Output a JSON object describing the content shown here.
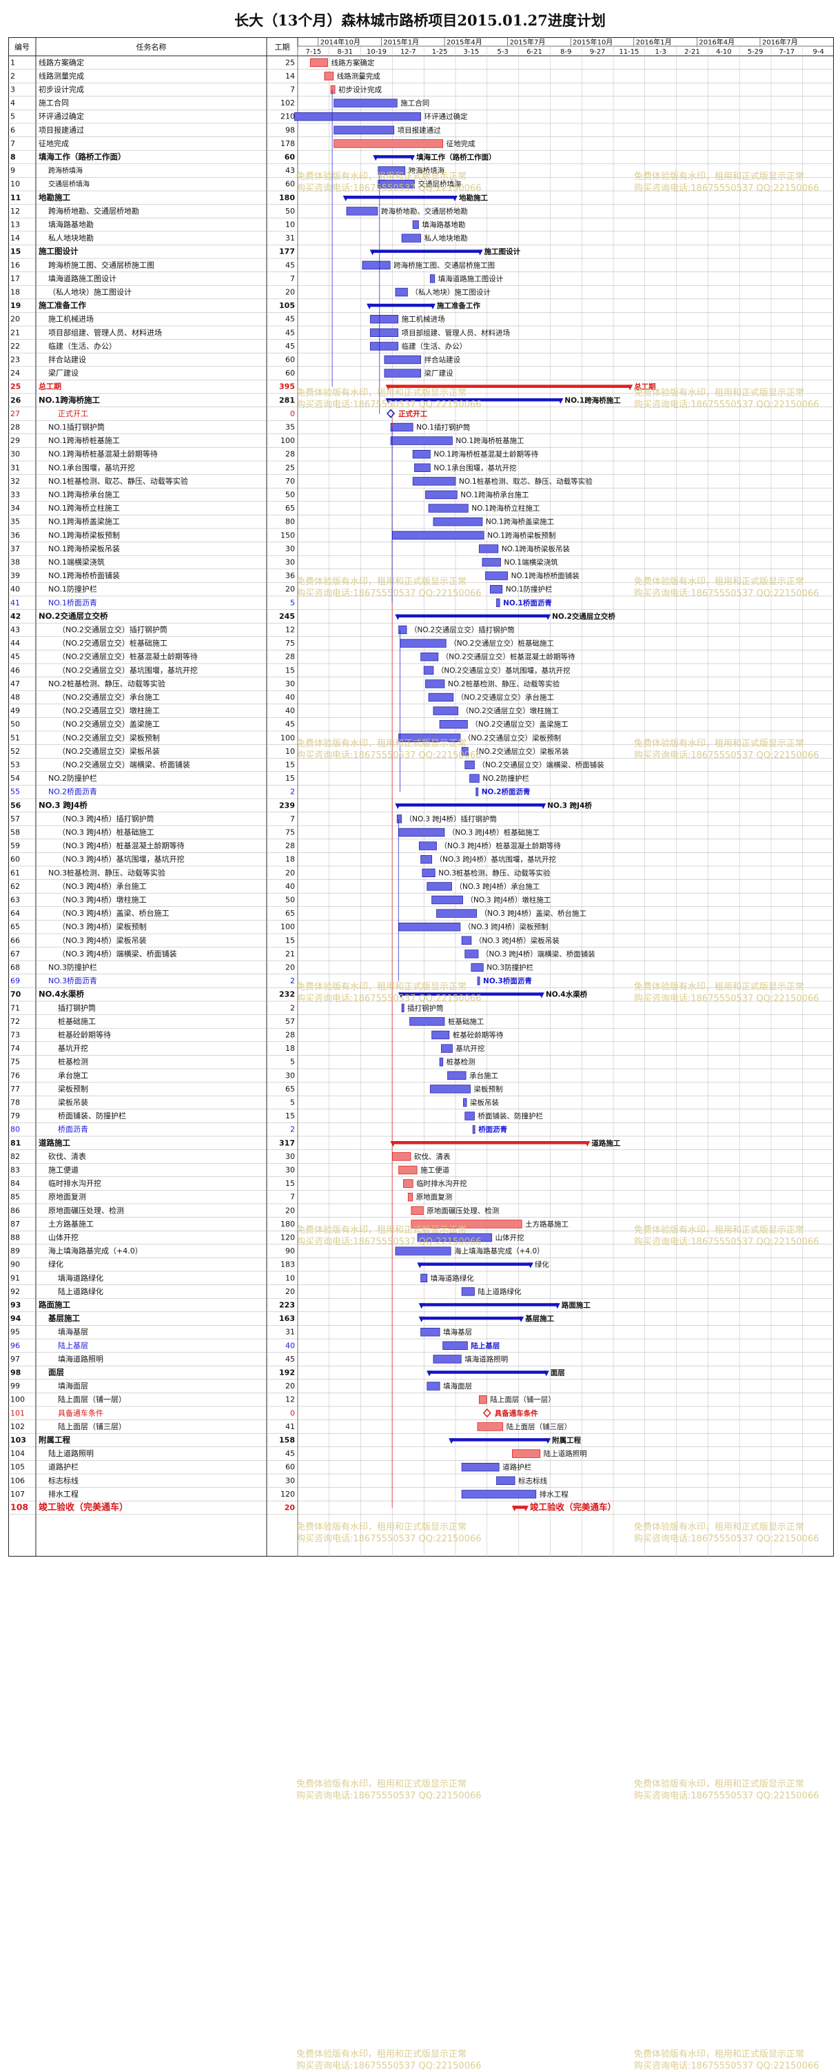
{
  "title": "长大（13个月）森林城市路桥项目2015.01.27进度计划",
  "headers": {
    "id": "编号",
    "name": "任务名称",
    "duration": "工期"
  },
  "timeline": {
    "months": [
      "2014年10月",
      "2015年1月",
      "2015年4月",
      "2015年7月",
      "2015年10月",
      "2016年1月",
      "2016年4月",
      "2016年7月"
    ],
    "weeks": [
      "7-15",
      "8-31",
      "10-19",
      "12-7",
      "1-25",
      "3-15",
      "5-3",
      "6-21",
      "8-9",
      "9-27",
      "11-15",
      "1-3",
      "2-21",
      "4-10",
      "5-29",
      "7-17",
      "9-4"
    ]
  },
  "watermark": {
    "line1": "免费体验版有水印，租用和正式版显示正常",
    "line2": "购买咨询电话:18675550537 QQ:22150066"
  },
  "colors": {
    "normal": "#6a6ae6",
    "summary": "#1414c8",
    "critical": "#e02020",
    "critical_light": "#f08080",
    "blue_text": "#1a1ad8",
    "red_text": "#d81818"
  },
  "tasks": [
    {
      "id": "1",
      "name": "线路方案确定",
      "dur": "25"
    },
    {
      "id": "2",
      "name": "线路测量完成",
      "dur": "14"
    },
    {
      "id": "3",
      "name": "初步设计完成",
      "dur": "7"
    },
    {
      "id": "4",
      "name": "施工合同",
      "dur": "102"
    },
    {
      "id": "5",
      "name": "环评通过确定",
      "dur": "210"
    },
    {
      "id": "6",
      "name": "项目报建通过",
      "dur": "98"
    },
    {
      "id": "7",
      "name": "征地完成",
      "dur": "178"
    },
    {
      "id": "8",
      "name": "填海工作（路桥工作面）",
      "dur": "60",
      "style": "summary"
    },
    {
      "id": "9",
      "name": "跨海桥填海",
      "dur": "43",
      "indent": 1,
      "small": true
    },
    {
      "id": "10",
      "name": "交通层桥填海",
      "dur": "60",
      "indent": 1,
      "small": true
    },
    {
      "id": "11",
      "name": "地勘施工",
      "dur": "180",
      "style": "summary"
    },
    {
      "id": "12",
      "name": "跨海桥地勘、交通层桥地勘",
      "dur": "50",
      "indent": 1
    },
    {
      "id": "13",
      "name": "填海路基地勘",
      "dur": "10",
      "indent": 1
    },
    {
      "id": "14",
      "name": "私人地块地勘",
      "dur": "31",
      "indent": 1
    },
    {
      "id": "15",
      "name": "施工图设计",
      "dur": "177",
      "style": "summary"
    },
    {
      "id": "16",
      "name": "跨海桥施工图、交通层桥施工图",
      "dur": "45",
      "indent": 1
    },
    {
      "id": "17",
      "name": "填海道路施工图设计",
      "dur": "7",
      "indent": 1
    },
    {
      "id": "18",
      "name": "（私人地块）施工图设计",
      "dur": "20",
      "indent": 1
    },
    {
      "id": "19",
      "name": "施工准备工作",
      "dur": "105",
      "style": "summary"
    },
    {
      "id": "20",
      "name": "施工机械进场",
      "dur": "45",
      "indent": 1
    },
    {
      "id": "21",
      "name": "项目部组建、管理人员、材料进场",
      "dur": "45",
      "indent": 1
    },
    {
      "id": "22",
      "name": "临建（生活、办公）",
      "dur": "45",
      "indent": 1
    },
    {
      "id": "23",
      "name": "拌合站建设",
      "dur": "60",
      "indent": 1
    },
    {
      "id": "24",
      "name": "梁厂建设",
      "dur": "60",
      "indent": 1
    },
    {
      "id": "25",
      "name": "总工期",
      "dur": "395",
      "style": "red"
    },
    {
      "id": "26",
      "name": "NO.1跨海桥施工",
      "dur": "281",
      "style": "summary"
    },
    {
      "id": "27",
      "name": "正式开工",
      "dur": "0",
      "style": "red",
      "indent": 2
    },
    {
      "id": "28",
      "name": "NO.1插打钢护筒",
      "dur": "35",
      "indent": 1
    },
    {
      "id": "29",
      "name": "NO.1跨海桥桩基施工",
      "dur": "100",
      "indent": 1
    },
    {
      "id": "30",
      "name": "NO.1跨海桥桩基混凝土龄期等待",
      "dur": "28",
      "indent": 1
    },
    {
      "id": "31",
      "name": "NO.1承台围堰，基坑开挖",
      "dur": "25",
      "indent": 1
    },
    {
      "id": "32",
      "name": "NO.1桩基检测、取芯、静压、动载等实验",
      "dur": "70",
      "indent": 1
    },
    {
      "id": "33",
      "name": "NO.1跨海桥承台施工",
      "dur": "50",
      "indent": 1
    },
    {
      "id": "34",
      "name": "NO.1跨海桥立柱施工",
      "dur": "65",
      "indent": 1
    },
    {
      "id": "35",
      "name": "NO.1跨海桥盖梁施工",
      "dur": "80",
      "indent": 1
    },
    {
      "id": "36",
      "name": "NO.1跨海桥梁板预制",
      "dur": "150",
      "indent": 1
    },
    {
      "id": "37",
      "name": "NO.1跨海桥梁板吊装",
      "dur": "30",
      "indent": 1
    },
    {
      "id": "38",
      "name": "NO.1端横梁浇筑",
      "dur": "30",
      "indent": 1
    },
    {
      "id": "39",
      "name": "NO.1跨海桥桥面铺装",
      "dur": "36",
      "indent": 1
    },
    {
      "id": "40",
      "name": "NO.1防撞护栏",
      "dur": "20",
      "indent": 1
    },
    {
      "id": "41",
      "name": "NO.1桥面沥青",
      "dur": "5",
      "style": "blue",
      "indent": 1
    },
    {
      "id": "42",
      "name": "NO.2交通层立交桥",
      "dur": "245",
      "style": "summary"
    },
    {
      "id": "43",
      "name": "（NO.2交通层立交）插打钢护筒",
      "dur": "12",
      "indent": 2
    },
    {
      "id": "44",
      "name": "（NO.2交通层立交）桩基础施工",
      "dur": "75",
      "indent": 2
    },
    {
      "id": "45",
      "name": "（NO.2交通层立交）桩基混凝土龄期等待",
      "dur": "28",
      "indent": 2
    },
    {
      "id": "46",
      "name": "（NO.2交通层立交）基坑围堰，基坑开挖",
      "dur": "15",
      "indent": 2
    },
    {
      "id": "47",
      "name": "NO.2桩基检测、静压、动载等实验",
      "dur": "30",
      "indent": 1
    },
    {
      "id": "48",
      "name": "（NO.2交通层立交）承台施工",
      "dur": "40",
      "indent": 2
    },
    {
      "id": "49",
      "name": "（NO.2交通层立交）墩柱施工",
      "dur": "40",
      "indent": 2
    },
    {
      "id": "50",
      "name": "（NO.2交通层立交）盖梁施工",
      "dur": "45",
      "indent": 2
    },
    {
      "id": "51",
      "name": "（NO.2交通层立交）梁板预制",
      "dur": "100",
      "indent": 2
    },
    {
      "id": "52",
      "name": "（NO.2交通层立交）梁板吊装",
      "dur": "10",
      "indent": 2
    },
    {
      "id": "53",
      "name": "（NO.2交通层立交）端横梁、桥面铺装",
      "dur": "15",
      "indent": 2
    },
    {
      "id": "54",
      "name": "NO.2防撞护栏",
      "dur": "15",
      "indent": 1
    },
    {
      "id": "55",
      "name": "NO.2桥面沥青",
      "dur": "2",
      "style": "blue",
      "indent": 1
    },
    {
      "id": "56",
      "name": "NO.3 跨J4桥",
      "dur": "239",
      "style": "summary"
    },
    {
      "id": "57",
      "name": "（NO.3 跨J4桥）插打钢护筒",
      "dur": "7",
      "indent": 2
    },
    {
      "id": "58",
      "name": "（NO.3 跨J4桥）桩基础施工",
      "dur": "75",
      "indent": 2
    },
    {
      "id": "59",
      "name": "（NO.3 跨J4桥）桩基混凝土龄期等待",
      "dur": "28",
      "indent": 2
    },
    {
      "id": "60",
      "name": "（NO.3 跨J4桥）基坑围堰，基坑开挖",
      "dur": "18",
      "indent": 2
    },
    {
      "id": "61",
      "name": "NO.3桩基检测、静压、动载等实验",
      "dur": "20",
      "indent": 1
    },
    {
      "id": "62",
      "name": "（NO.3 跨J4桥）承台施工",
      "dur": "40",
      "indent": 2
    },
    {
      "id": "63",
      "name": "（NO.3 跨J4桥）墩柱施工",
      "dur": "50",
      "indent": 2
    },
    {
      "id": "64",
      "name": "（NO.3 跨J4桥）盖梁、桥台施工",
      "dur": "65",
      "indent": 2
    },
    {
      "id": "65",
      "name": "（NO.3 跨J4桥）梁板预制",
      "dur": "100",
      "indent": 2
    },
    {
      "id": "66",
      "name": "（NO.3 跨J4桥）梁板吊装",
      "dur": "15",
      "indent": 2
    },
    {
      "id": "67",
      "name": "（NO.3 跨J4桥）端横梁、桥面铺装",
      "dur": "21",
      "indent": 2
    },
    {
      "id": "68",
      "name": "NO.3防撞护栏",
      "dur": "20",
      "indent": 1
    },
    {
      "id": "69",
      "name": "NO.3桥面沥青",
      "dur": "2",
      "style": "blue",
      "indent": 1
    },
    {
      "id": "70",
      "name": "NO.4水渠桥",
      "dur": "232",
      "style": "summary"
    },
    {
      "id": "71",
      "name": "插打钢护筒",
      "dur": "2",
      "indent": 2
    },
    {
      "id": "72",
      "name": "桩基础施工",
      "dur": "57",
      "indent": 2
    },
    {
      "id": "73",
      "name": "桩基砼龄期等待",
      "dur": "28",
      "indent": 2
    },
    {
      "id": "74",
      "name": "基坑开挖",
      "dur": "18",
      "indent": 2
    },
    {
      "id": "75",
      "name": "桩基检测",
      "dur": "5",
      "indent": 2
    },
    {
      "id": "76",
      "name": "承台施工",
      "dur": "30",
      "indent": 2
    },
    {
      "id": "77",
      "name": "梁板预制",
      "dur": "65",
      "indent": 2
    },
    {
      "id": "78",
      "name": "梁板吊装",
      "dur": "5",
      "indent": 2
    },
    {
      "id": "79",
      "name": "桥面铺装、防撞护栏",
      "dur": "15",
      "indent": 2
    },
    {
      "id": "80",
      "name": "桥面沥青",
      "dur": "2",
      "style": "blue",
      "indent": 2
    },
    {
      "id": "81",
      "name": "道路施工",
      "dur": "317",
      "style": "summary"
    },
    {
      "id": "82",
      "name": "砍伐、清表",
      "dur": "30",
      "indent": 1
    },
    {
      "id": "83",
      "name": "施工便道",
      "dur": "30",
      "indent": 1
    },
    {
      "id": "84",
      "name": "临时排水沟开挖",
      "dur": "15",
      "indent": 1
    },
    {
      "id": "85",
      "name": "原地面复测",
      "dur": "7",
      "indent": 1
    },
    {
      "id": "86",
      "name": "原地面碾压处理、检测",
      "dur": "20",
      "indent": 1
    },
    {
      "id": "87",
      "name": "土方路基施工",
      "dur": "180",
      "indent": 1
    },
    {
      "id": "88",
      "name": "山体开挖",
      "dur": "120",
      "indent": 1
    },
    {
      "id": "89",
      "name": "海上填海路基完成（+4.0）",
      "dur": "90",
      "indent": 1
    },
    {
      "id": "90",
      "name": "绿化",
      "dur": "183",
      "indent": 1
    },
    {
      "id": "91",
      "name": "填海道路绿化",
      "dur": "10",
      "indent": 2
    },
    {
      "id": "92",
      "name": "陆上道路绿化",
      "dur": "20",
      "indent": 2
    },
    {
      "id": "93",
      "name": "路面施工",
      "dur": "223",
      "style": "summary"
    },
    {
      "id": "94",
      "name": "基层施工",
      "dur": "163",
      "style": "summary",
      "indent": 1
    },
    {
      "id": "95",
      "name": "填海基层",
      "dur": "31",
      "indent": 2
    },
    {
      "id": "96",
      "name": "陆上基层",
      "dur": "40",
      "style": "blue",
      "indent": 2
    },
    {
      "id": "97",
      "name": "填海道路照明",
      "dur": "45",
      "indent": 2
    },
    {
      "id": "98",
      "name": "面层",
      "dur": "192",
      "style": "summary",
      "indent": 1
    },
    {
      "id": "99",
      "name": "填海面层",
      "dur": "20",
      "indent": 2
    },
    {
      "id": "100",
      "name": "陆上面层（铺一层）",
      "dur": "12",
      "indent": 2
    },
    {
      "id": "101",
      "name": "具备通车条件",
      "dur": "0",
      "style": "red",
      "indent": 2
    },
    {
      "id": "102",
      "name": "陆上面层（铺三层）",
      "dur": "41",
      "indent": 2
    },
    {
      "id": "103",
      "name": "附属工程",
      "dur": "158",
      "style": "summary"
    },
    {
      "id": "104",
      "name": "陆上道路照明",
      "dur": "45",
      "indent": 1
    },
    {
      "id": "105",
      "name": "道路护栏",
      "dur": "60",
      "indent": 1
    },
    {
      "id": "106",
      "name": "标志标线",
      "dur": "30",
      "indent": 1
    },
    {
      "id": "107",
      "name": "排水工程",
      "dur": "120",
      "indent": 1
    },
    {
      "id": "108",
      "name": "竣工验收（完美通车）",
      "dur": "20",
      "style": "final"
    }
  ]
}
